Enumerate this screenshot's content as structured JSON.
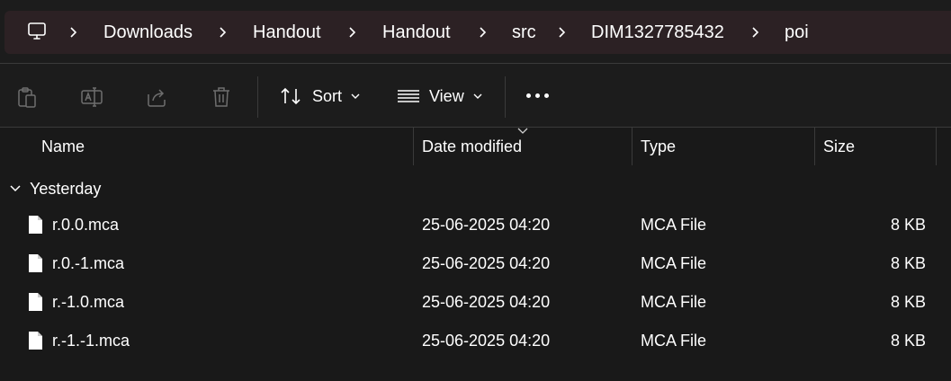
{
  "address_bar": {
    "computer_icon": "computer-icon",
    "separator_icon": "chevron-right-icon",
    "breadcrumbs": [
      "Downloads",
      "Handout",
      "Handout",
      "src",
      "DIM1327785432",
      "poi"
    ]
  },
  "toolbar": {
    "icons": [
      "paste-icon",
      "rename-icon",
      "share-icon",
      "delete-icon"
    ],
    "sort_label": "Sort",
    "view_label": "View",
    "more_icon": "more-options-icon"
  },
  "columns": {
    "name": "Name",
    "date_modified": "Date modified",
    "type": "Type",
    "size": "Size"
  },
  "group": {
    "label": "Yesterday",
    "expanded": true
  },
  "files": [
    {
      "name": "r.0.0.mca",
      "date": "25-06-2025 04:20",
      "type": "MCA File",
      "size": "8 KB"
    },
    {
      "name": "r.0.-1.mca",
      "date": "25-06-2025 04:20",
      "type": "MCA File",
      "size": "8 KB"
    },
    {
      "name": "r.-1.0.mca",
      "date": "25-06-2025 04:20",
      "type": "MCA File",
      "size": "8 KB"
    },
    {
      "name": "r.-1.-1.mca",
      "date": "25-06-2025 04:20",
      "type": "MCA File",
      "size": "8 KB"
    }
  ],
  "colors": {
    "background": "#191919",
    "address_bar": "#2c2124",
    "separator": "#3a3a3a",
    "text": "#ffffff",
    "disabled_icon": "#6e6e6e"
  }
}
